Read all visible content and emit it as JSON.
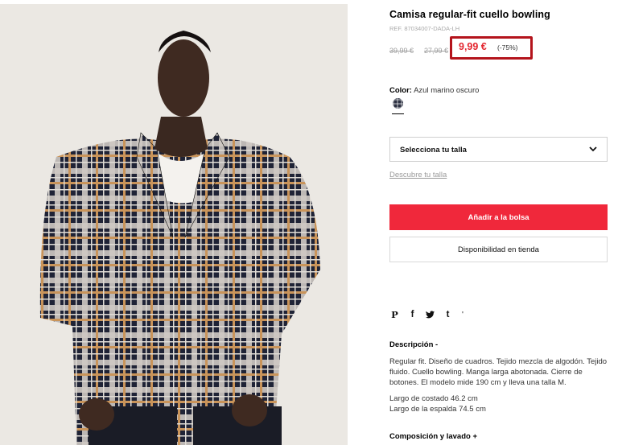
{
  "product": {
    "title": "Camisa regular-fit cuello bowling",
    "ref": "REF. 87034007-DADA-LH",
    "old_price_1": "39,99 €",
    "old_price_2": "27,99 €",
    "price": "9,99 €",
    "discount": "(-75%)",
    "color_label": "Color:",
    "color_value": "Azul marino oscuro",
    "swatch_icon": "navy-check-swatch"
  },
  "size": {
    "select_label": "Selecciona tu talla",
    "guide_link": "Descubre tu talla"
  },
  "actions": {
    "add_to_bag": "Añadir a la bolsa",
    "store_availability": "Disponibilidad en tienda"
  },
  "social": {
    "pinterest": "P",
    "facebook": "f",
    "twitter": "t",
    "tumblr": "t",
    "share": "'"
  },
  "description": {
    "title": "Descripción  -",
    "body": "Regular fit. Diseño de cuadros. Tejido mezcla de algodón. Tejido fluido. Cuello bowling. Manga larga abotonada. Cierre de botones. El modelo mide 190 cm y lleva una talla M.",
    "measure_1": "Largo de costado 46.2 cm",
    "measure_2": "Largo de la espalda 74.5 cm"
  },
  "composition": {
    "title": "Composición y lavado  +"
  },
  "colors": {
    "sale_red": "#e3262f",
    "highlight_border": "#b4141c",
    "add_button": "#f0283b"
  }
}
